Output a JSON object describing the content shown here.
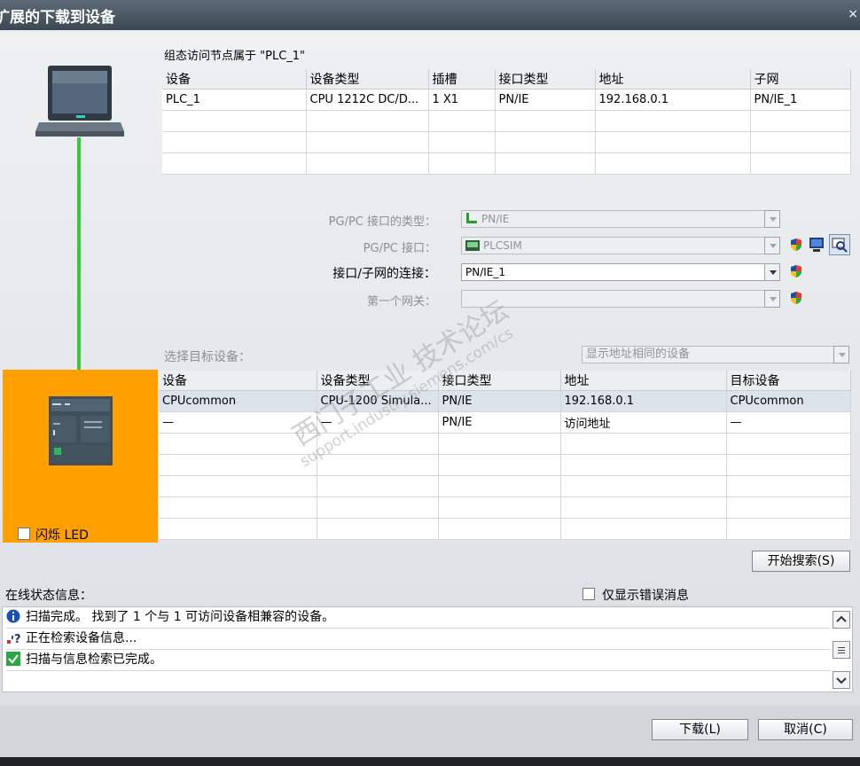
{
  "window": {
    "title": "扩展的下载到设备",
    "close": "×"
  },
  "node_section": {
    "caption": "组态访问节点属于 \"PLC_1\"",
    "columns": [
      "设备",
      "设备类型",
      "插槽",
      "接口类型",
      "地址",
      "子网"
    ],
    "rows": [
      [
        "PLC_1",
        "CPU 1212C DC/D...",
        "1 X1",
        "PN/IE",
        "192.168.0.1",
        "PN/IE_1"
      ]
    ]
  },
  "interface": {
    "pgpc_type_label": "PG/PC 接口的类型：",
    "pgpc_type_value": "PN/IE",
    "pgpc_if_label": "PG/PC 接口：",
    "pgpc_if_value": "PLCSIM",
    "subnet_conn_label": "接口/子网的连接：",
    "subnet_conn_value": "PN/IE_1",
    "gateway_label": "第一个网关：",
    "gateway_value": ""
  },
  "target": {
    "label": "选择目标设备：",
    "filter_value": "显示地址相同的设备",
    "columns": [
      "设备",
      "设备类型",
      "接口类型",
      "地址",
      "目标设备"
    ],
    "rows": [
      [
        "CPUcommon",
        "CPU-1200 Simula...",
        "PN/IE",
        "192.168.0.1",
        "CPUcommon"
      ],
      [
        "—",
        "—",
        "PN/IE",
        "访问地址",
        "—"
      ]
    ]
  },
  "flash_led_label": "闪烁 LED",
  "start_search_label": "开始搜索(S)",
  "status": {
    "label": "在线状态信息：",
    "errors_only_label": "仅显示错误消息",
    "messages": [
      {
        "icon": "info-icon",
        "text": "扫描完成。 找到了 1 个与 1 可访问设备相兼容的设备。"
      },
      {
        "icon": "search-device-icon",
        "text": "正在检索设备信息..."
      },
      {
        "icon": "check-icon",
        "text": "扫描与信息检索已完成。"
      }
    ]
  },
  "footer": {
    "download_label": "下载(L)",
    "cancel_label": "取消(C)"
  },
  "watermark": {
    "line1": "西门子工业 技术论坛",
    "line2": "support.industry.siemens.com/cs"
  },
  "colors": {
    "titlebar": "#4a5763",
    "plc_panel": "#ffa000",
    "link_line": "#33cc33",
    "selected_row": "#dde3ea"
  }
}
